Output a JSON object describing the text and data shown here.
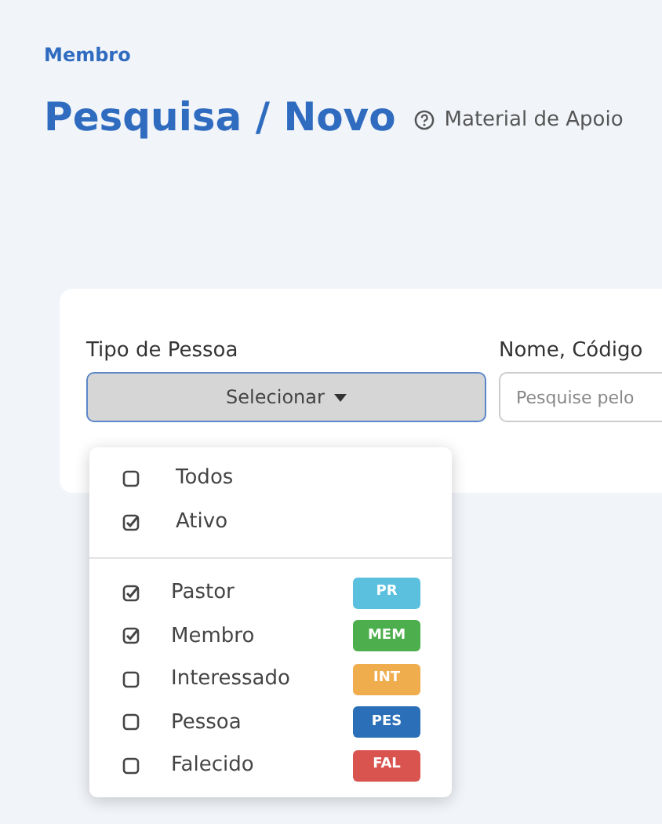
{
  "breadcrumb": "Membro",
  "title": "Pesquisa / Novo",
  "help_link": "Material de Apoio",
  "filters": {
    "type_label": "Tipo de Pessoa",
    "type_button": "Selecionar",
    "name_label": "Nome, Código",
    "name_placeholder": "Pesquise pelo"
  },
  "dropdown": {
    "status_options": [
      {
        "label": "Todos",
        "checked": false
      },
      {
        "label": "Ativo",
        "checked": true
      }
    ],
    "type_options": [
      {
        "label": "Pastor",
        "checked": true,
        "badge": "PR",
        "color": "#5bc0de"
      },
      {
        "label": "Membro",
        "checked": true,
        "badge": "MEM",
        "color": "#4cae4c"
      },
      {
        "label": "Interessado",
        "checked": false,
        "badge": "INT",
        "color": "#f0ad4e"
      },
      {
        "label": "Pessoa",
        "checked": false,
        "badge": "PES",
        "color": "#2a6fb8"
      },
      {
        "label": "Falecido",
        "checked": false,
        "badge": "FAL",
        "color": "#d9534f"
      }
    ]
  }
}
